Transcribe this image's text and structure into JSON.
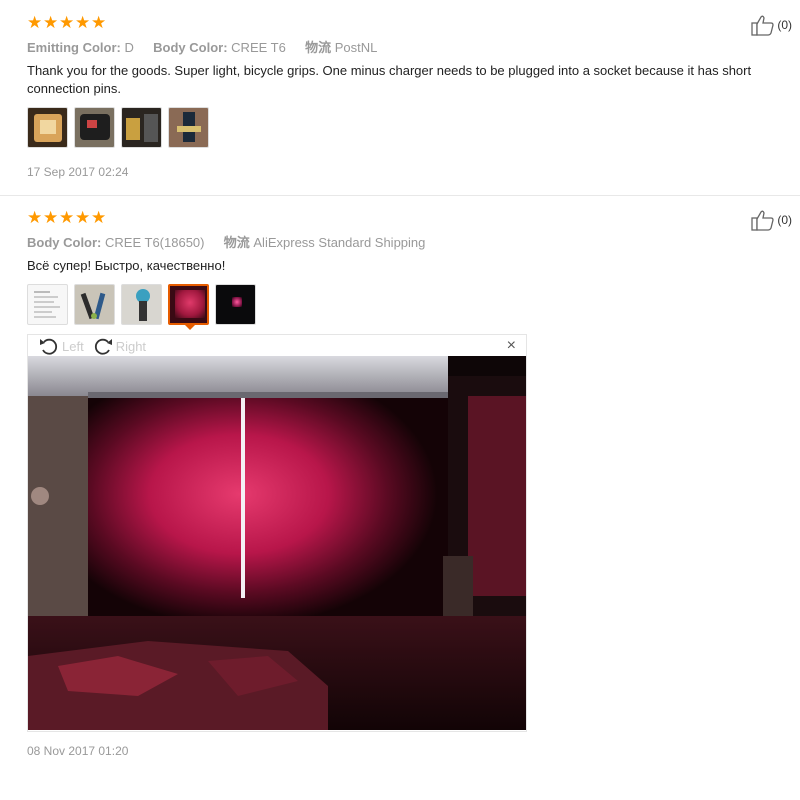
{
  "colors": {
    "star": "#ff9900",
    "accent": "#e65c00",
    "muted": "#999999"
  },
  "reviews": [
    {
      "rating": 5,
      "likes": "(0)",
      "attributes": [
        {
          "key": "Emitting Color:",
          "value": "D"
        },
        {
          "key": "Body Color:",
          "value": "CREE T6"
        },
        {
          "key": "物流",
          "value": "PostNL"
        }
      ],
      "text": "Thank you for the goods. Super light, bicycle grips. One minus charger needs to be plugged into a socket because it has short connection pins.",
      "thumbnails": [
        "package-photo",
        "bag-photo",
        "kit-photo",
        "bike-photo"
      ],
      "date": "17 Sep 2017 02:24"
    },
    {
      "rating": 5,
      "likes": "(0)",
      "attributes": [
        {
          "key": "Body Color:",
          "value": "CREE T6(18650)"
        },
        {
          "key": "物流",
          "value": "AliExpress Standard Shipping"
        }
      ],
      "text": "Всё супер! Быстро, качественно!",
      "thumbnails": [
        "document-photo",
        "parts-photo",
        "lamp-photo",
        "red-curtain-photo",
        "dark-photo"
      ],
      "active_thumbnail": 3,
      "viewer": {
        "rotate_left_label": "Left",
        "rotate_right_label": "Right",
        "close_label": "×"
      },
      "date": "08 Nov 2017 01:20"
    }
  ]
}
